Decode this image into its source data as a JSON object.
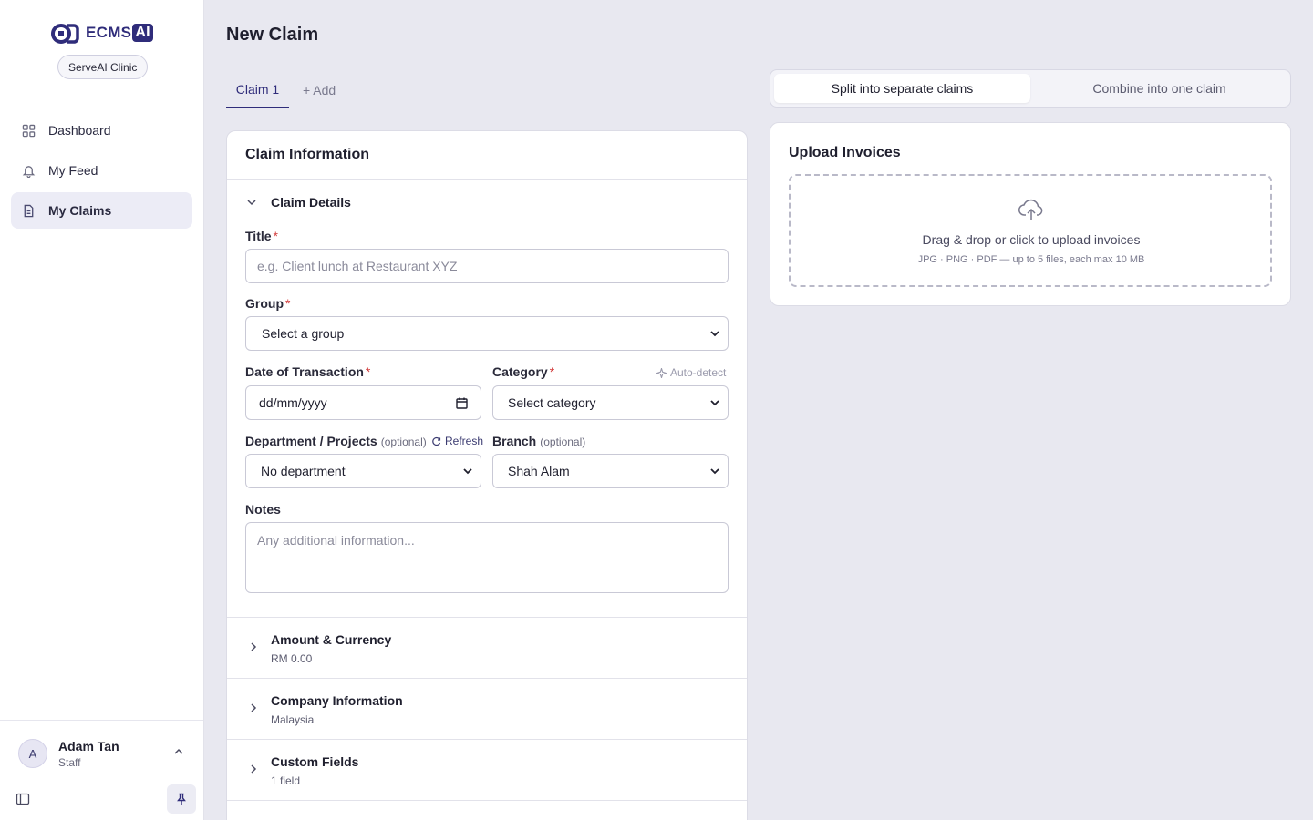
{
  "sidebar": {
    "brand": {
      "name": "ECMS",
      "suffix": "AI"
    },
    "org": "ServeAI Clinic",
    "nav": [
      {
        "label": "Dashboard",
        "icon": "grid-icon"
      },
      {
        "label": "My Feed",
        "icon": "bell-icon"
      },
      {
        "label": "My Claims",
        "icon": "document-icon",
        "active": true
      }
    ],
    "user": {
      "initial": "A",
      "name": "Adam Tan",
      "role": "Staff"
    }
  },
  "page": {
    "title": "New Claim"
  },
  "tabs": [
    {
      "label": "Claim 1"
    },
    {
      "label": "+ Add"
    }
  ],
  "claim_card": {
    "title": "Claim Information",
    "details_section": "Claim Details",
    "fields": {
      "title": {
        "label": "Title",
        "placeholder": "e.g. Client lunch at Restaurant XYZ"
      },
      "group": {
        "label": "Group",
        "value": "Select a group"
      },
      "date": {
        "label": "Date of Transaction",
        "value": "dd/mm/yyyy"
      },
      "category": {
        "label": "Category",
        "value": "Select category",
        "auto_detect": "Auto-detect"
      },
      "department": {
        "label": "Department / Projects",
        "optional": "(optional)",
        "refresh": "Refresh",
        "value": "No department"
      },
      "branch": {
        "label": "Branch",
        "optional": "(optional)",
        "value": "Shah Alam"
      },
      "notes": {
        "label": "Notes",
        "placeholder": "Any additional information..."
      }
    },
    "collapsed_sections": [
      {
        "title": "Amount & Currency",
        "summary": "RM 0.00"
      },
      {
        "title": "Company Information",
        "summary": "Malaysia"
      },
      {
        "title": "Custom Fields",
        "summary": "1 field"
      }
    ]
  },
  "mode_toggle": {
    "split": "Split into separate claims",
    "combine": "Combine into one claim",
    "selected": "split"
  },
  "upload": {
    "title": "Upload Invoices",
    "prompt": "Drag & drop or click to upload invoices",
    "hint": "JPG · PNG · PDF — up to 5 files, each max 10 MB"
  },
  "colors": {
    "brand": "#2f2c7a",
    "required": "#d23a3a",
    "background": "#e8e8f0"
  }
}
